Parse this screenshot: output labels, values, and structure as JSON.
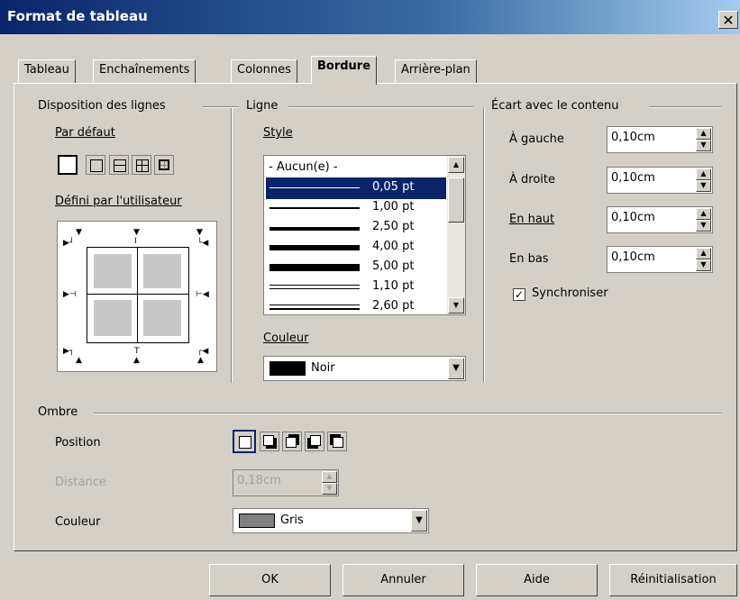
{
  "window": {
    "title": "Format de tableau",
    "close_glyph": "✕"
  },
  "tabs": [
    "Tableau",
    "Enchaînements",
    "Colonnes",
    "Bordure",
    "Arrière-plan"
  ],
  "active_tab": "Bordure",
  "line_arrangement": {
    "heading": "Disposition des lignes",
    "default_label": "Par défaut",
    "user_defined_label": "Défini par l'utilisateur"
  },
  "line": {
    "heading": "Ligne",
    "style_label": "Style",
    "styles": [
      "- Aucun(e) -",
      "0,05 pt",
      "1,00 pt",
      "2,50 pt",
      "4,00 pt",
      "5,00 pt",
      "1,10 pt",
      "2,60 pt"
    ],
    "selected_style": "0,05 pt",
    "color_label": "Couleur",
    "color_value": "Noir",
    "color_swatch": "#000000"
  },
  "spacing": {
    "heading": "Écart avec le contenu",
    "left_label": "À gauche",
    "left_value": "0,10cm",
    "right_label": "À droite",
    "right_value": "0,10cm",
    "top_label": "En haut",
    "top_value": "0,10cm",
    "bottom_label": "En bas",
    "bottom_value": "0,10cm",
    "sync_label": "Synchroniser",
    "sync_checked": true
  },
  "shadow": {
    "heading": "Ombre",
    "position_label": "Position",
    "distance_label": "Distance",
    "distance_value": "0,18cm",
    "color_label": "Couleur",
    "color_value": "Gris",
    "color_swatch": "#808080"
  },
  "buttons": {
    "ok": "OK",
    "cancel": "Annuler",
    "help": "Aide",
    "reset": "Réinitialisation"
  },
  "colors": {
    "title_start": "#0a246a",
    "selection": "#0a246a",
    "face": "#d4d0c8"
  }
}
